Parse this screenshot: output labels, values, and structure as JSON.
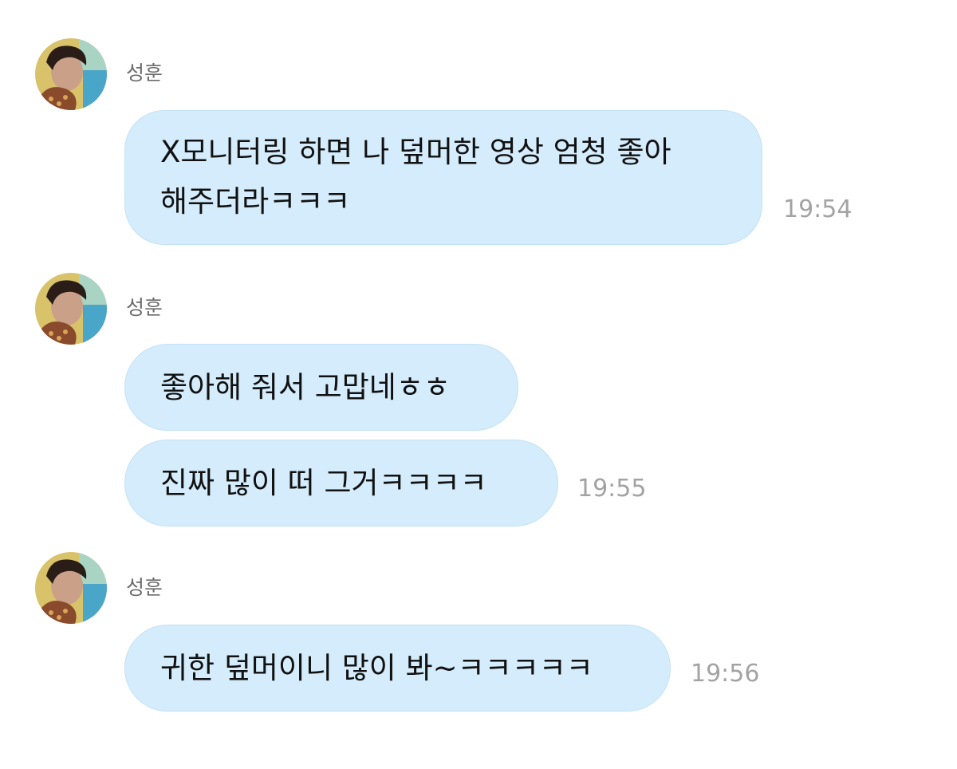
{
  "groups": [
    {
      "sender": "성훈",
      "messages": [
        {
          "lines": [
            "X모니터링 하면 나 덮머한 영상 엄청 좋아",
            "해주더라ㅋㅋㅋ"
          ]
        }
      ],
      "time": "19:54"
    },
    {
      "sender": "성훈",
      "messages": [
        {
          "lines": [
            "좋아해 줘서 고맙네ㅎㅎ"
          ]
        },
        {
          "lines": [
            "진짜 많이 떠 그거ㅋㅋㅋㅋ"
          ]
        }
      ],
      "time": "19:55"
    },
    {
      "sender": "성훈",
      "messages": [
        {
          "lines": [
            "귀한 덮머이니 많이 봐~ㅋㅋㅋㅋㅋ"
          ]
        }
      ],
      "time": "19:56"
    }
  ],
  "colors": {
    "bubble": "#d4ecfb",
    "timestamp": "#a3a3a3",
    "sender": "#6b6b6b"
  }
}
